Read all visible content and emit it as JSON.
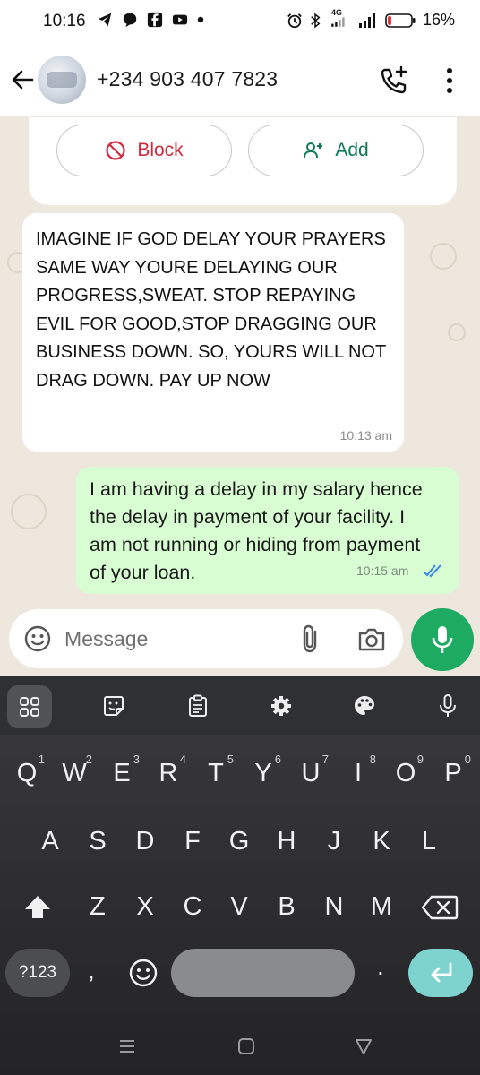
{
  "status_bar": {
    "time": "10:16",
    "notification_icons": [
      "telegram-icon",
      "chat-bubble-icon",
      "facebook-icon",
      "youtube-icon",
      "dot-icon"
    ],
    "network_label": "4G",
    "battery_percent": "16%",
    "battery_level": 0.16
  },
  "header": {
    "contact": "+234 903 407 7823",
    "icons": [
      "back-arrow-icon",
      "add-call-icon",
      "more-vert-icon"
    ]
  },
  "contact_card": {
    "block_label": "Block",
    "add_label": "Add"
  },
  "messages": [
    {
      "direction": "incoming",
      "text": "IMAGINE IF GOD DELAY YOUR PRAYERS SAME WAY YOURE DELAYING OUR PROGRESS,SWEAT. STOP REPAYING EVIL FOR GOOD,STOP DRAGGING OUR BUSINESS DOWN. SO, YOURS WILL NOT DRAG DOWN. PAY UP NOW",
      "time": "10:13 am"
    },
    {
      "direction": "outgoing",
      "text": "I am having a delay in my salary hence the delay in payment of your facility. I am not running or hiding from payment of your loan.",
      "time": "10:15 am",
      "status": "read"
    }
  ],
  "composer": {
    "placeholder": "Message",
    "icons": [
      "emoji-icon",
      "attach-icon",
      "camera-icon",
      "mic-icon"
    ]
  },
  "keyboard": {
    "toolbar": [
      "apps-grid-icon",
      "sticker-icon",
      "clipboard-icon",
      "settings-icon",
      "theme-palette-icon",
      "voice-input-icon"
    ],
    "row1": [
      {
        "key": "Q",
        "hint": "1"
      },
      {
        "key": "W",
        "hint": "2"
      },
      {
        "key": "E",
        "hint": "3"
      },
      {
        "key": "R",
        "hint": "4"
      },
      {
        "key": "T",
        "hint": "5"
      },
      {
        "key": "Y",
        "hint": "6"
      },
      {
        "key": "U",
        "hint": "7"
      },
      {
        "key": "I",
        "hint": "8"
      },
      {
        "key": "O",
        "hint": "9"
      },
      {
        "key": "P",
        "hint": "0"
      }
    ],
    "row2": [
      "A",
      "S",
      "D",
      "F",
      "G",
      "H",
      "J",
      "K",
      "L"
    ],
    "row3": [
      "Z",
      "X",
      "C",
      "V",
      "B",
      "N",
      "M"
    ],
    "symbols_label": "?123",
    "comma": ",",
    "period": "."
  },
  "nav_bar": [
    "recents-icon",
    "home-icon",
    "back-icon"
  ]
}
